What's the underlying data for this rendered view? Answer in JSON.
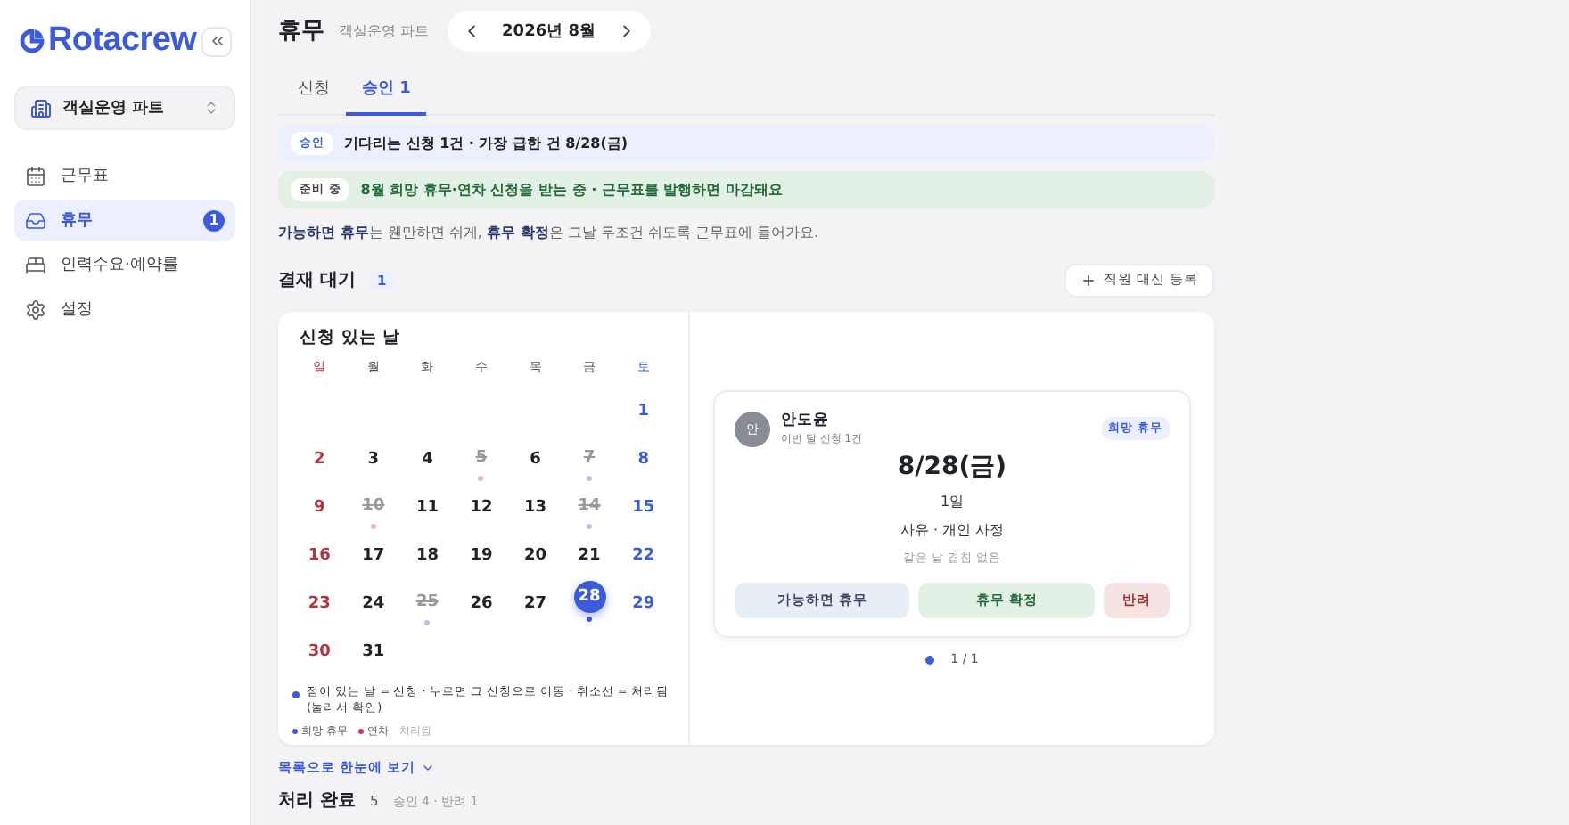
{
  "sidebar": {
    "logo": "Rotacrew",
    "team": "객실운영 파트",
    "items": [
      {
        "label": "근무표",
        "selected": false
      },
      {
        "label": "휴무",
        "selected": true,
        "badge": "1"
      },
      {
        "label": "인력수요·예약률",
        "selected": false
      },
      {
        "label": "설정",
        "selected": false
      }
    ]
  },
  "header": {
    "title": "휴무",
    "subtitle": "객실운영 파트",
    "month": "2026년 8월"
  },
  "tabs": [
    {
      "label": "신청",
      "selected": false
    },
    {
      "label": "승인 1",
      "selected": true
    }
  ],
  "banners": [
    {
      "kind": "info",
      "tag": "승인",
      "text": "기다리는 신청 1건 · 가장 급한 건 8/28(금)"
    },
    {
      "kind": "success",
      "tag": "준비 중",
      "text": "8월 희망 휴무·연차 신청을 받는 중 · 근무표를 발행하면 마감돼요"
    }
  ],
  "note": "**가능하면 휴무**는 웬만하면 쉬게, **휴무 확정**은 그날 무조건 쉬도록 근무표에 들어가요.",
  "pending": {
    "title": "결재 대기",
    "count": "1",
    "add_button": "직원 대신 등록"
  },
  "calendar": {
    "title": "신청 있는 날",
    "weekdays": [
      "일",
      "월",
      "화",
      "수",
      "목",
      "금",
      "토"
    ],
    "weeks": [
      [
        {
          "label": "1",
          "processed": false,
          "selected": false
        }
      ],
      [
        {
          "label": "2",
          "processed": false,
          "selected": false
        },
        {
          "label": "3",
          "processed": false,
          "selected": false
        },
        {
          "label": "4",
          "processed": false,
          "selected": false
        },
        {
          "label": "5",
          "processed": true,
          "selected": false,
          "color": "#f0b3c6"
        },
        {
          "label": "6",
          "processed": false,
          "selected": false
        },
        {
          "label": "7",
          "processed": true,
          "selected": false,
          "color": "#b9c3ee"
        },
        {
          "label": "8",
          "processed": false,
          "selected": false
        }
      ],
      [
        {
          "label": "9",
          "processed": false,
          "selected": false
        },
        {
          "label": "10",
          "processed": true,
          "selected": false,
          "color": "#f0b3c6"
        },
        {
          "label": "11",
          "processed": false,
          "selected": false
        },
        {
          "label": "12",
          "processed": false,
          "selected": false
        },
        {
          "label": "13",
          "processed": false,
          "selected": false
        },
        {
          "label": "14",
          "processed": true,
          "selected": false,
          "color": "#b9c3ee"
        },
        {
          "label": "15",
          "processed": false,
          "selected": false
        }
      ],
      [
        {
          "label": "16",
          "processed": false,
          "selected": false
        },
        {
          "label": "17",
          "processed": false,
          "selected": false
        },
        {
          "label": "18",
          "processed": false,
          "selected": false
        },
        {
          "label": "19",
          "processed": false,
          "selected": false
        },
        {
          "label": "20",
          "processed": false,
          "selected": false
        },
        {
          "label": "21",
          "processed": false,
          "selected": false
        },
        {
          "label": "22",
          "processed": false,
          "selected": false
        }
      ],
      [
        {
          "label": "23",
          "processed": false,
          "selected": false
        },
        {
          "label": "24",
          "processed": false,
          "selected": false
        },
        {
          "label": "25",
          "processed": true,
          "selected": false,
          "color": "#b9c3ee"
        },
        {
          "label": "26",
          "processed": false,
          "selected": false
        },
        {
          "label": "27",
          "processed": false,
          "selected": false
        },
        {
          "label": "28",
          "processed": false,
          "selected": true,
          "color": "#3b5bdb"
        },
        {
          "label": "29",
          "processed": false,
          "selected": false
        }
      ],
      [
        {
          "label": "30",
          "processed": false,
          "selected": false
        },
        {
          "label": "31",
          "processed": false,
          "selected": false
        }
      ]
    ],
    "hint": "점이 있는 날 = 신청 · 누르면 그 신청으로 이동 · 취소선 = 처리됨(눌러서 확인)",
    "legend": [
      {
        "label": "희망 휴무",
        "color": "#3b5bdb"
      },
      {
        "label": "연차",
        "color": "#d6336c"
      },
      {
        "label": "처리됨"
      }
    ]
  },
  "request": {
    "avatar": "안",
    "name": "안도윤",
    "meta": "이번 달 신청 1건",
    "type": "희망 휴무",
    "date": "8/28(금)",
    "days": "1일",
    "reason": "사유 · 개인 사정",
    "overlap": "같은 날 겹침 없음",
    "actions": [
      {
        "kind": "soft",
        "label": "가능하면 휴무"
      },
      {
        "kind": "confirm",
        "label": "휴무 확정"
      },
      {
        "kind": "reject",
        "label": "반려"
      }
    ],
    "pager": "1 / 1"
  },
  "list_link": "목록으로 한눈에 보기",
  "done": {
    "title": "처리 완료",
    "count": "5",
    "summary": "승인 4 · 반려 1"
  }
}
